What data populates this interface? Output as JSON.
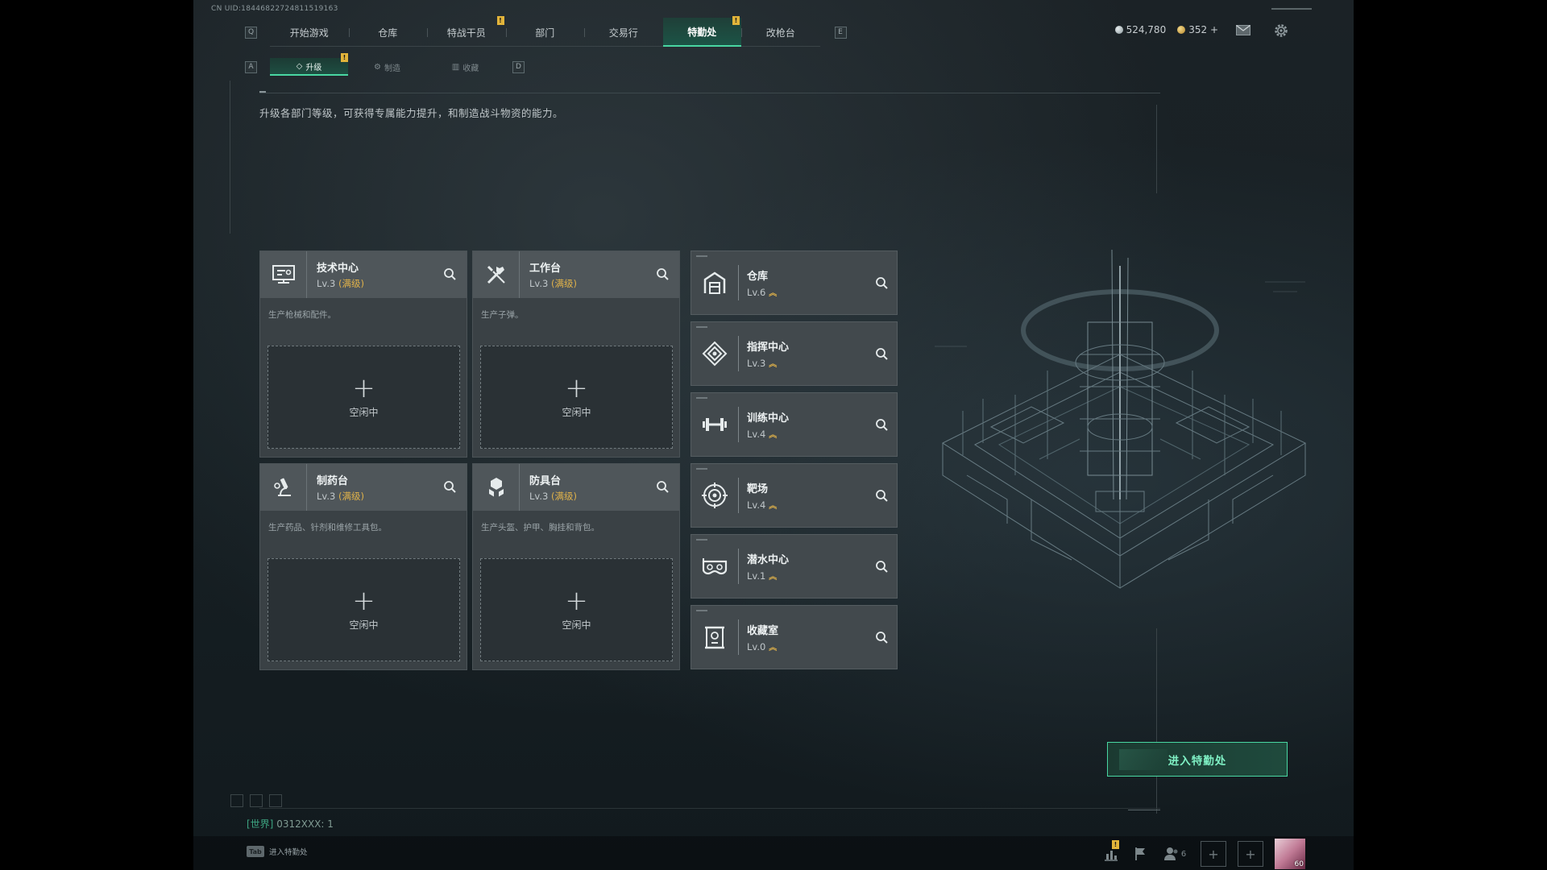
{
  "uid": "CN UID:18446822724811519163",
  "top_nav": {
    "key_left": "Q",
    "key_right": "E",
    "tabs": [
      {
        "label": "开始游戏",
        "active": false,
        "badge": ""
      },
      {
        "label": "仓库",
        "active": false,
        "badge": ""
      },
      {
        "label": "特战干员",
        "active": false,
        "badge": "!"
      },
      {
        "label": "部门",
        "active": false,
        "badge": ""
      },
      {
        "label": "交易行",
        "active": false,
        "badge": ""
      },
      {
        "label": "特勤处",
        "active": true,
        "badge": "!"
      },
      {
        "label": "改枪台",
        "active": false,
        "badge": ""
      }
    ]
  },
  "currency": {
    "silver": "524,780",
    "gold": "352",
    "gold_add": "+"
  },
  "sub_nav": {
    "key_left": "A",
    "key_right": "D",
    "tabs": [
      {
        "label": "升级",
        "icon": "◇",
        "active": true,
        "badge": "!"
      },
      {
        "label": "制造",
        "icon": "⚙",
        "active": false,
        "badge": ""
      },
      {
        "label": "收藏",
        "icon": "▥",
        "active": false,
        "badge": ""
      }
    ]
  },
  "description": "升级各部门等级，可获得专属能力提升，和制造战斗物资的能力。",
  "cards": [
    {
      "title": "技术中心",
      "level": "Lv.3",
      "max": "(满级)",
      "desc": "生产枪械和配件。",
      "slot_plus": "+",
      "slot_label": "空闲中",
      "icon": "tech-center-icon"
    },
    {
      "title": "工作台",
      "level": "Lv.3",
      "max": "(满级)",
      "desc": "生产子弹。",
      "slot_plus": "+",
      "slot_label": "空闲中",
      "icon": "workbench-icon"
    },
    {
      "title": "制药台",
      "level": "Lv.3",
      "max": "(满级)",
      "desc": "生产药品、针剂和维修工具包。",
      "slot_plus": "+",
      "slot_label": "空闲中",
      "icon": "pharmacy-icon"
    },
    {
      "title": "防具台",
      "level": "Lv.3",
      "max": "(满级)",
      "desc": "生产头盔、护甲、胸挂和背包。",
      "slot_plus": "+",
      "slot_label": "空闲中",
      "icon": "armor-bench-icon"
    }
  ],
  "departments": [
    {
      "title": "仓库",
      "level": "Lv.6",
      "icon": "warehouse-icon"
    },
    {
      "title": "指挥中心",
      "level": "Lv.3",
      "icon": "command-center-icon"
    },
    {
      "title": "训练中心",
      "level": "Lv.4",
      "icon": "training-center-icon"
    },
    {
      "title": "靶场",
      "level": "Lv.4",
      "icon": "shooting-range-icon"
    },
    {
      "title": "潜水中心",
      "level": "Lv.1",
      "icon": "diving-center-icon"
    },
    {
      "title": "收藏室",
      "level": "Lv.0",
      "icon": "collection-room-icon"
    }
  ],
  "enter_button": "进入特勤处",
  "chat": {
    "channel": "[世界]",
    "message": "0312XXX: 1"
  },
  "tab_hint": {
    "key": "Tab",
    "label": "进入特勤处"
  },
  "bottom_bar": {
    "friends_count": "6",
    "avatar_level": "60",
    "badge": "!"
  },
  "colors": {
    "accent": "#49d7a2",
    "max_level": "#e0b24a",
    "badge": "#e2b43a"
  }
}
